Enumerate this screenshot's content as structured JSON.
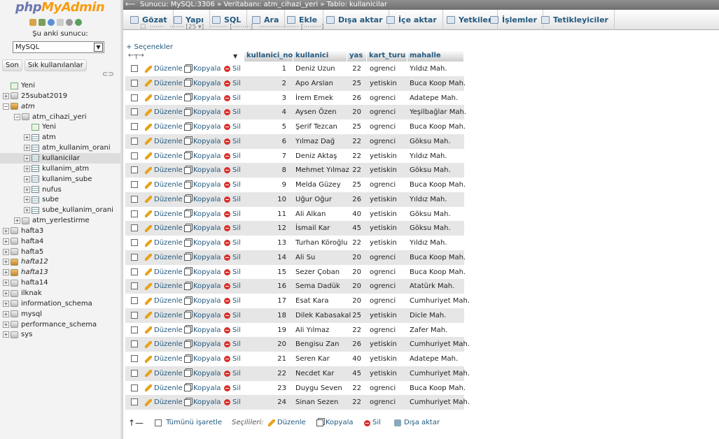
{
  "sidebar": {
    "logo_php": "php",
    "logo_myadmin": "MyAdmin",
    "server_label": "Şu anki sunucu:",
    "server_value": "MySQL",
    "tab_recent": "Son",
    "tab_favorites": "Sık kullanılanlar",
    "tree": [
      {
        "label": "Yeni",
        "level": 0,
        "kind": "new"
      },
      {
        "label": "25subat2019",
        "level": 0,
        "kind": "db"
      },
      {
        "label": "atm",
        "level": 0,
        "kind": "db-locked",
        "italic": true
      },
      {
        "label": "atm_cihazi_yeri",
        "level": 1,
        "kind": "db"
      },
      {
        "label": "Yeni",
        "level": 2,
        "kind": "new"
      },
      {
        "label": "atm",
        "level": 2,
        "kind": "table"
      },
      {
        "label": "atm_kullanim_orani",
        "level": 2,
        "kind": "table"
      },
      {
        "label": "kullanicilar",
        "level": 2,
        "kind": "table",
        "selected": true
      },
      {
        "label": "kullanim_atm",
        "level": 2,
        "kind": "table"
      },
      {
        "label": "kullanim_sube",
        "level": 2,
        "kind": "table"
      },
      {
        "label": "nufus",
        "level": 2,
        "kind": "table"
      },
      {
        "label": "sube",
        "level": 2,
        "kind": "table"
      },
      {
        "label": "sube_kullanim_orani",
        "level": 2,
        "kind": "table"
      },
      {
        "label": "atm_yerlestirme",
        "level": 1,
        "kind": "db"
      },
      {
        "label": "hafta3",
        "level": 0,
        "kind": "db"
      },
      {
        "label": "hafta4",
        "level": 0,
        "kind": "db"
      },
      {
        "label": "hafta5",
        "level": 0,
        "kind": "db"
      },
      {
        "label": "hafta12",
        "level": 0,
        "kind": "db-locked",
        "italic": true
      },
      {
        "label": "hafta13",
        "level": 0,
        "kind": "db-locked",
        "italic": true
      },
      {
        "label": "hafta14",
        "level": 0,
        "kind": "db"
      },
      {
        "label": "ilknak",
        "level": 0,
        "kind": "db"
      },
      {
        "label": "information_schema",
        "level": 0,
        "kind": "db"
      },
      {
        "label": "mysql",
        "level": 0,
        "kind": "db"
      },
      {
        "label": "performance_schema",
        "level": 0,
        "kind": "db"
      },
      {
        "label": "sys",
        "level": 0,
        "kind": "db"
      }
    ]
  },
  "topbar": {
    "breadcrumb": "Sunucu: MySQL:3306 » Veritabanı: atm_cihazi_yeri » Tablo: kullanicilar"
  },
  "tabs": [
    "Gözat",
    "Yapı",
    "SQL",
    "Ara",
    "Ekle",
    "Dışa aktar",
    "İçe aktar",
    "Yetkiler",
    "İşlemler",
    "Tetikleyiciler"
  ],
  "secenekler": "+ Seçenekler",
  "columns": [
    "kullanici_no",
    "kullanici",
    "yas",
    "kart_turu",
    "mahalle"
  ],
  "actions": {
    "edit": "Düzenle",
    "copy": "Kopyala",
    "delete": "Sil"
  },
  "rows": [
    [
      1,
      "Deniz Uzun",
      22,
      "ogrenci",
      "Yıldız Mah."
    ],
    [
      2,
      "Apo Arslan",
      25,
      "yetiskin",
      "Buca Koop Mah."
    ],
    [
      3,
      "İrem Emek",
      26,
      "ogrenci",
      "Adatepe Mah."
    ],
    [
      4,
      "Aysen Özen",
      20,
      "ogrenci",
      "Yeşilbağlar Mah."
    ],
    [
      5,
      "Şerif Tezcan",
      25,
      "ogrenci",
      "Buca Koop Mah."
    ],
    [
      6,
      "Yılmaz Dağ",
      22,
      "ogrenci",
      "Göksu Mah."
    ],
    [
      7,
      "Deniz Aktaş",
      22,
      "yetiskin",
      "Yıldız Mah."
    ],
    [
      8,
      "Mehmet Yılmaz",
      22,
      "yetiskin",
      "Göksu Mah."
    ],
    [
      9,
      "Melda Güzey",
      25,
      "ogrenci",
      "Buca Koop Mah."
    ],
    [
      10,
      "Uğur Oğur",
      26,
      "yetiskin",
      "Yıldız Mah."
    ],
    [
      11,
      "Ali Alkan",
      40,
      "yetiskin",
      "Göksu Mah."
    ],
    [
      12,
      "İsmail Kar",
      45,
      "yetiskin",
      "Göksu Mah."
    ],
    [
      13,
      "Turhan Köroğlu",
      22,
      "yetiskin",
      "Yıldız Mah."
    ],
    [
      14,
      "Ali Su",
      20,
      "ogrenci",
      "Buca Koop Mah."
    ],
    [
      15,
      "Sezer Çoban",
      20,
      "ogrenci",
      "Buca Koop Mah."
    ],
    [
      16,
      "Sema Dadük",
      20,
      "ogrenci",
      "Atatürk Mah."
    ],
    [
      17,
      "Esat Kara",
      20,
      "ogrenci",
      "Cumhuriyet Mah."
    ],
    [
      18,
      "Dilek Kabasakal",
      25,
      "yetiskin",
      "Dicle Mah."
    ],
    [
      19,
      "Ali Yılmaz",
      22,
      "ogrenci",
      "Zafer Mah."
    ],
    [
      20,
      "Bengisu Zan",
      26,
      "yetiskin",
      "Cumhuriyet Mah."
    ],
    [
      21,
      "Seren Kar",
      40,
      "yetiskin",
      "Adatepe Mah."
    ],
    [
      22,
      "Necdet Kar",
      45,
      "yetiskin",
      "Cumhuriyet Mah."
    ],
    [
      23,
      "Duygu Seven",
      22,
      "ogrenci",
      "Buca Koop Mah."
    ],
    [
      24,
      "Sinan Sezen",
      22,
      "ogrenci",
      "Cumhuriyet Mah."
    ]
  ],
  "footer": {
    "check_all": "Tümünü işaretle",
    "with_selected": "Seçilileri:",
    "edit": "Düzenle",
    "copy": "Kopyala",
    "delete": "Sil",
    "export": "Dışa aktar"
  }
}
